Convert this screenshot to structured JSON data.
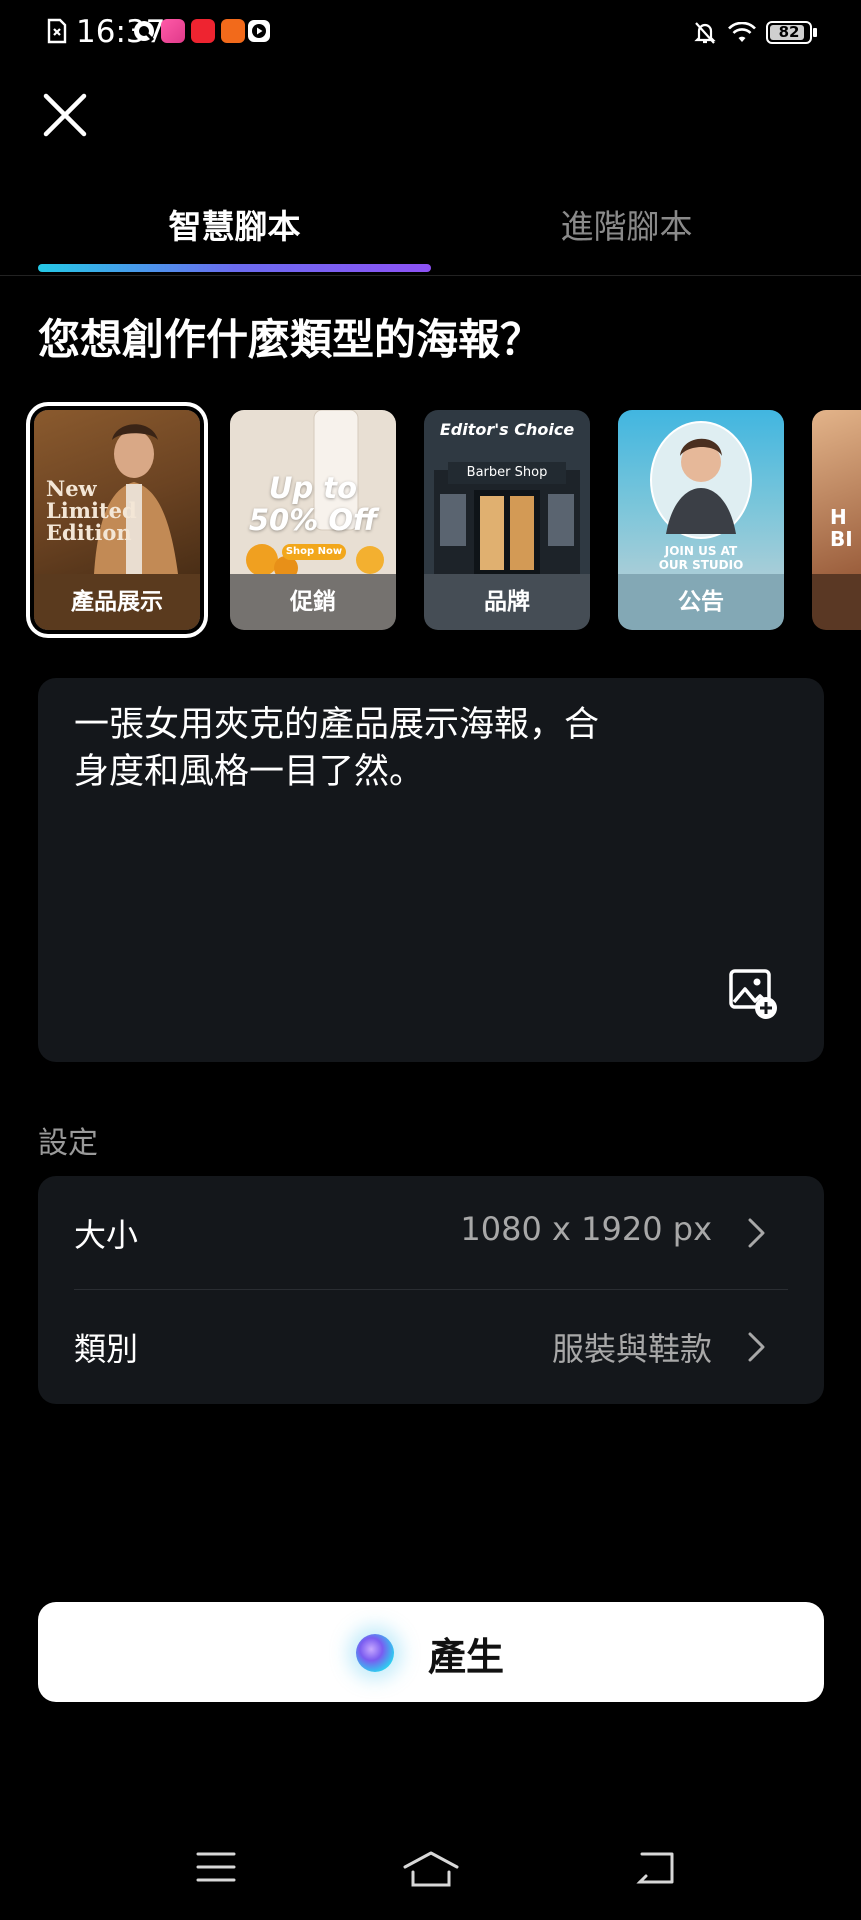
{
  "status_bar": {
    "time": "16:37",
    "battery": "82",
    "icons": [
      "sim-card-icon",
      "chat-app-icon",
      "shop-app-icon",
      "red-app-icon",
      "orange-app-icon",
      "play-icon",
      "bell-off-icon",
      "wifi-icon",
      "battery-icon"
    ]
  },
  "tabs": [
    {
      "label": "智慧腳本",
      "active": true
    },
    {
      "label": "進階腳本",
      "active": false
    }
  ],
  "question": "您想創作什麼類型的海報？",
  "templates": [
    {
      "label": "產品展示",
      "overlay_lines": [
        "New",
        "Limited",
        "Edition"
      ],
      "selected": true
    },
    {
      "label": "促銷",
      "overlay_lines": [
        "Up to",
        "50% Off"
      ],
      "badge": "Shop Now"
    },
    {
      "label": "品牌",
      "overlay_lines": [
        "Editor's Choice",
        "Barber Shop"
      ]
    },
    {
      "label": "公告",
      "overlay_lines": [
        "JOIN US AT",
        "OUR STUDIO"
      ]
    },
    {
      "label": "",
      "overlay_lines": [
        "H",
        "BI"
      ]
    }
  ],
  "prompt": {
    "text_line1": "一張女用夾克的產品展示海報，合",
    "text_line2": "身度和風格一目了然。"
  },
  "settings": {
    "title": "設定",
    "rows": [
      {
        "label": "大小",
        "value": "1080 x 1920 px"
      },
      {
        "label": "類別",
        "value": "服裝與鞋款"
      }
    ]
  },
  "generate_label": "產生",
  "colors": {
    "background": "#000000",
    "panel": "#14171b",
    "tab_gradient": [
      "#25c9e6",
      "#8d52f5"
    ]
  }
}
